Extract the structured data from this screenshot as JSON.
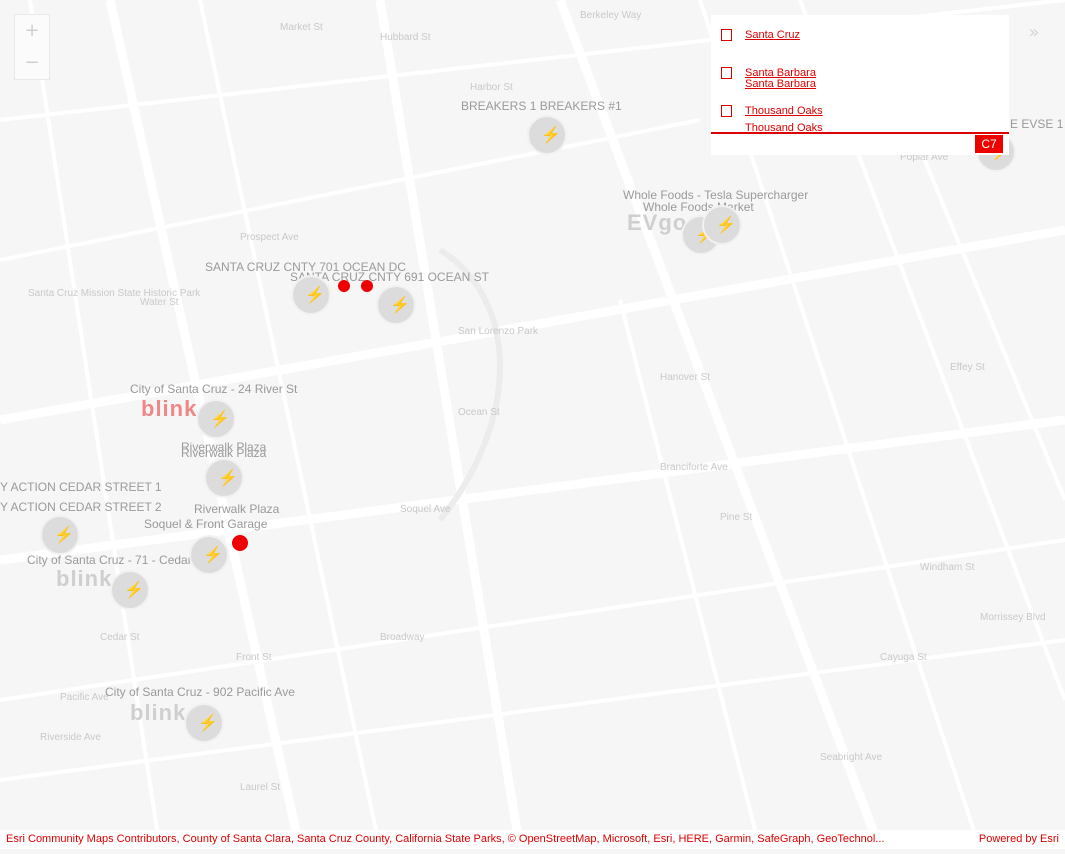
{
  "map": {
    "streets": [
      "Hubbard St",
      "Berkeley Way",
      "Harbor St",
      "Prospect Ave",
      "Cedar St",
      "Pacific Ave",
      "Front St",
      "Water St",
      "Ocean St",
      "Soquel Ave",
      "Riverside Ave",
      "Laurel St",
      "Broadway",
      "Seabright Ave",
      "Pine St",
      "Branciforte Ave",
      "Windham St",
      "Morrissey Blvd",
      "Market St",
      "Poplar Ave",
      "Hanover St",
      "Effey St",
      "Cayuga St"
    ],
    "places": [
      "Santa Cruz Mission State Historic Park",
      "San Lorenzo Park"
    ],
    "pois": [
      {
        "label": "BREAKERS 1 BREAKERS #1"
      },
      {
        "label": "SANTA CRUZ CNTY 701 OCEAN DC"
      },
      {
        "label": "SANTA CRUZ CNTY 691 OCEAN ST"
      },
      {
        "label": "City of Santa Cruz - 24 River St"
      },
      {
        "label": "Riverwalk Plaza"
      },
      {
        "label": "Riverwalk Plaza"
      },
      {
        "label": "Y ACTION CEDAR STREET 1"
      },
      {
        "label": "Y ACTION CEDAR STREET 2"
      },
      {
        "label": "Riverwalk Plaza"
      },
      {
        "label": "Soquel & Front Garage"
      },
      {
        "label": "City of Santa Cruz - 71 - Cedar Street"
      },
      {
        "label": "City of Santa Cruz - 902 Pacific Ave"
      },
      {
        "label": "Whole Foods - Tesla Supercharger"
      },
      {
        "label": "Whole Foods Market"
      },
      {
        "label": "E EVSE 1"
      }
    ],
    "logos": [
      "blink",
      "blink",
      "blink",
      "EVgo"
    ]
  },
  "controls": {
    "zoom_in": "+",
    "zoom_out": "−",
    "expand": "»"
  },
  "panel": {
    "items": [
      "Santa Cruz",
      "Santa Barbara",
      "Santa Barbara",
      "Thousand Oaks",
      "Thousand Oaks"
    ],
    "bar_button": "C7"
  },
  "attribution": {
    "text": "Esri Community Maps Contributors, County of Santa Clara, Santa Cruz County, California State Parks, © OpenStreetMap, Microsoft, Esri, HERE, Garmin, SafeGraph, GeoTechnol...",
    "powered": "Powered by Esri"
  },
  "colors": {
    "accent": "#dd0000",
    "base": "#f6f6f6",
    "marker": "#dcdcdc"
  }
}
